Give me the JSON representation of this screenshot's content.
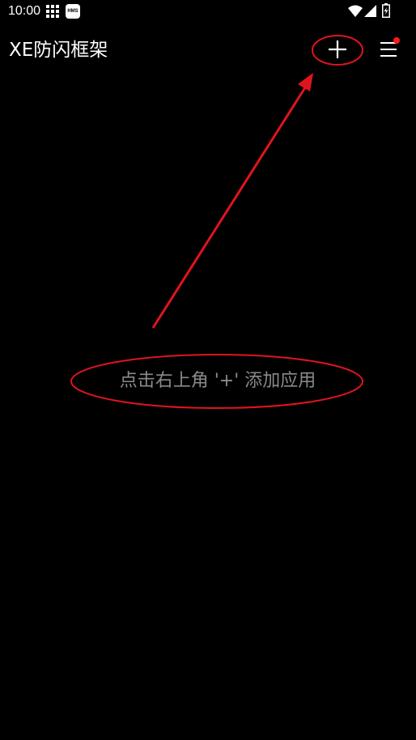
{
  "status_bar": {
    "time": "10:00",
    "icons": [
      "grid-icon",
      "hms-icon",
      "wifi-icon",
      "signal-icon",
      "battery-icon"
    ],
    "hms_label": "HMS"
  },
  "toolbar": {
    "title": "XE防闪框架",
    "add_icon": "plus-icon",
    "menu_icon": "hamburger-menu-icon",
    "menu_badge_color": "#ff1a1a"
  },
  "content": {
    "empty_hint": "点击右上角 '+' 添加应用"
  },
  "colors": {
    "background": "#000000",
    "text": "#ffffff",
    "hint_text": "#8a8a8a",
    "annotation": "#e0141e"
  }
}
